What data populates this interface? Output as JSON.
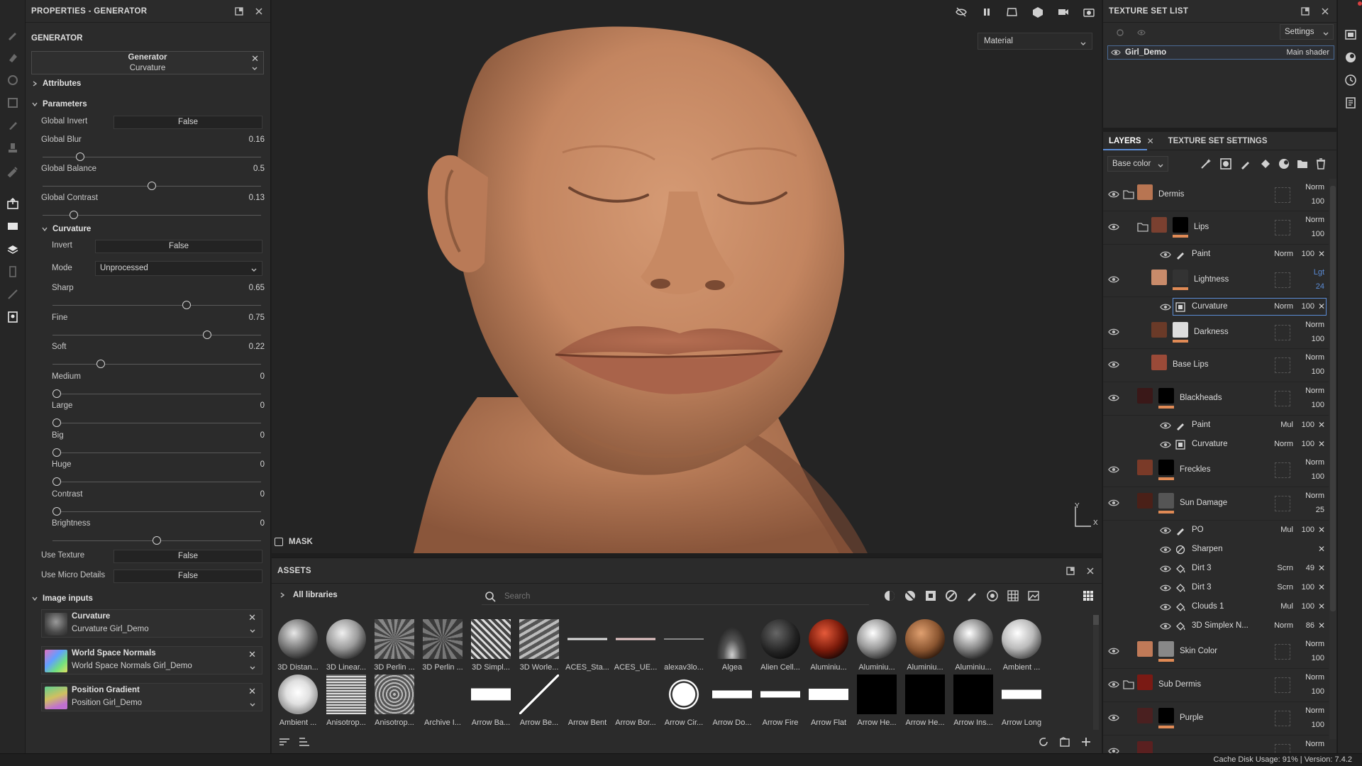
{
  "colors": {
    "accent": "#5b8bd4",
    "skin": "#c98b66",
    "panel": "#2b2b2b",
    "background": "#1e1e1e",
    "mask_bar": "#e08a55"
  },
  "properties": {
    "title": "PROPERTIES - GENERATOR",
    "section": "GENERATOR",
    "generator_name": "Generator",
    "generator_type": "Curvature",
    "attributes_label": "Attributes",
    "parameters_label": "Parameters",
    "params": [
      {
        "label": "Global Invert",
        "value": "False"
      },
      {
        "label": "Global Blur",
        "value": "0.16",
        "level": 0.16
      },
      {
        "label": "Global Balance",
        "value": "0.5",
        "level": 0.5
      },
      {
        "label": "Global Contrast",
        "value": "0.13",
        "level": 0.13
      }
    ],
    "curvature_label": "Curvature",
    "curv_params": [
      {
        "label": "Invert",
        "value": "False"
      },
      {
        "label": "Mode",
        "value": "Unprocessed"
      },
      {
        "label": "Sharp",
        "value": "0.65",
        "level": 0.65
      },
      {
        "label": "Fine",
        "value": "0.75",
        "level": 0.75
      },
      {
        "label": "Soft",
        "value": "0.22",
        "level": 0.22
      },
      {
        "label": "Medium",
        "value": "0",
        "level": 0
      },
      {
        "label": "Large",
        "value": "0",
        "level": 0
      },
      {
        "label": "Big",
        "value": "0",
        "level": 0
      },
      {
        "label": "Huge",
        "value": "0",
        "level": 0
      },
      {
        "label": "Contrast",
        "value": "0",
        "level": 0
      },
      {
        "label": "Brightness",
        "value": "0",
        "level": 0.5
      }
    ],
    "use_texture": {
      "label": "Use Texture",
      "value": "False"
    },
    "use_micro": {
      "label": "Use Micro Details",
      "value": "False"
    },
    "image_inputs_label": "Image inputs",
    "image_inputs": [
      {
        "name": "Curvature",
        "source": "Curvature Girl_Demo"
      },
      {
        "name": "World Space Normals",
        "source": "World Space Normals Girl_Demo"
      },
      {
        "name": "Position Gradient",
        "source": "Position Girl_Demo"
      }
    ]
  },
  "viewport": {
    "material_select": "Material",
    "mask_label": "MASK",
    "axis_y": "Y",
    "axis_x": "X",
    "icons": [
      "eye-off-icon",
      "pause-icon",
      "camera-frame-icon",
      "cube-icon",
      "video-camera-icon",
      "screenshot-icon"
    ]
  },
  "assets": {
    "title": "ASSETS",
    "all_libraries": "All libraries",
    "search_placeholder": "Search",
    "row1": [
      {
        "name": "3D Distan..."
      },
      {
        "name": "3D Linear..."
      },
      {
        "name": "3D Perlin ..."
      },
      {
        "name": "3D Perlin ..."
      },
      {
        "name": "3D Simpl..."
      },
      {
        "name": "3D Worle..."
      },
      {
        "name": "ACES_Sta..."
      },
      {
        "name": "ACES_UE..."
      },
      {
        "name": "alexav3lo..."
      },
      {
        "name": "Algea"
      },
      {
        "name": "Alien Cell..."
      },
      {
        "name": "Aluminiu..."
      },
      {
        "name": "Aluminiu..."
      },
      {
        "name": "Aluminiu..."
      },
      {
        "name": "Aluminiu..."
      },
      {
        "name": "Ambient ..."
      }
    ],
    "row2": [
      {
        "name": "Ambient ..."
      },
      {
        "name": "Anisotrop..."
      },
      {
        "name": "Anisotrop..."
      },
      {
        "name": "Archive I..."
      },
      {
        "name": "Arrow Ba..."
      },
      {
        "name": "Arrow Be..."
      },
      {
        "name": "Arrow Bent"
      },
      {
        "name": "Arrow Bor..."
      },
      {
        "name": "Arrow Cir..."
      },
      {
        "name": "Arrow Do..."
      },
      {
        "name": "Arrow Fire"
      },
      {
        "name": "Arrow Flat"
      },
      {
        "name": "Arrow He..."
      },
      {
        "name": "Arrow He..."
      },
      {
        "name": "Arrow Ins..."
      },
      {
        "name": "Arrow Long"
      }
    ]
  },
  "texture_set": {
    "title": "TEXTURE SET LIST",
    "settings": "Settings",
    "set_name": "Girl_Demo",
    "shader": "Main shader"
  },
  "layers": {
    "tab_layers": "LAYERS",
    "tab_settings": "TEXTURE SET SETTINGS",
    "channel": "Base color",
    "items": [
      {
        "name": "Dermis",
        "blend": "Norm",
        "opacity": "100"
      },
      {
        "name": "Lips",
        "blend": "Norm",
        "opacity": "100"
      },
      {
        "name": "Lightness",
        "blend": "Lgt",
        "opacity": "24"
      },
      {
        "name": "Darkness",
        "blend": "Norm",
        "opacity": "100"
      },
      {
        "name": "Base Lips",
        "blend": "Norm",
        "opacity": "100"
      },
      {
        "name": "Blackheads",
        "blend": "Norm",
        "opacity": "100"
      },
      {
        "name": "Freckles",
        "blend": "Norm",
        "opacity": "100"
      },
      {
        "name": "Sun Damage",
        "blend": "Norm",
        "opacity": "25"
      },
      {
        "name": "Skin Color",
        "blend": "Norm",
        "opacity": "100"
      },
      {
        "name": "Sub Dermis",
        "blend": "Norm",
        "opacity": "100"
      },
      {
        "name": "Purple",
        "blend": "Norm",
        "opacity": "100"
      },
      {
        "name": "",
        "blend": "Norm",
        "opacity": ""
      }
    ],
    "effects": [
      {
        "name": "Paint",
        "blend": "Norm",
        "opacity": "100"
      },
      {
        "name": "Curvature",
        "blend": "Norm",
        "opacity": "100"
      },
      {
        "name": "Paint",
        "blend": "Mul",
        "opacity": "100"
      },
      {
        "name": "Curvature",
        "blend": "Norm",
        "opacity": "100"
      },
      {
        "name": "PO",
        "blend": "Mul",
        "opacity": "100"
      },
      {
        "name": "Sharpen",
        "blend": "",
        "opacity": ""
      },
      {
        "name": "Dirt 3",
        "blend": "Scrn",
        "opacity": "49"
      },
      {
        "name": "Dirt 3",
        "blend": "Scrn",
        "opacity": "100"
      },
      {
        "name": "Clouds 1",
        "blend": "Mul",
        "opacity": "100"
      },
      {
        "name": "3D Simplex N...",
        "blend": "Norm",
        "opacity": "86"
      }
    ]
  },
  "status": {
    "text": "Cache Disk Usage:   91% | Version: 7.4.2"
  }
}
